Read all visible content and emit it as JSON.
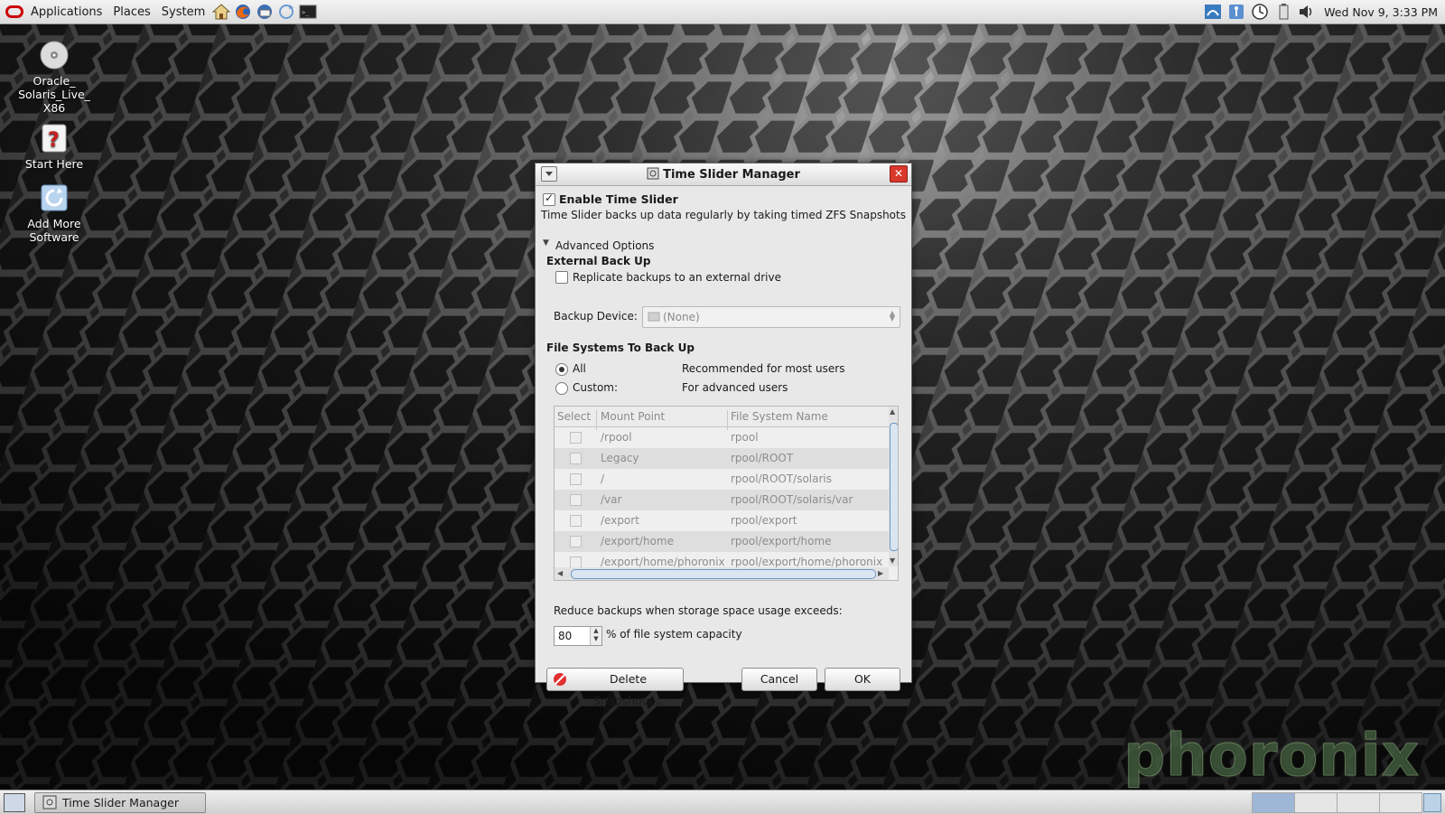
{
  "top_panel": {
    "menus": [
      "Applications",
      "Places",
      "System"
    ],
    "launchers": [
      "home-icon",
      "firefox-icon",
      "thunderbird-icon",
      "update-icon",
      "terminal-icon"
    ],
    "tray_icons": [
      "network-icon",
      "accessibility-icon",
      "time-slider-icon",
      "battery-icon",
      "volume-icon"
    ],
    "clock": "Wed Nov  9,  3:33 PM"
  },
  "desktop_icons": [
    {
      "label": "Oracle_\nSolaris_Live_\nX86",
      "icon": "disc-icon"
    },
    {
      "label": "Start Here",
      "icon": "help-icon"
    },
    {
      "label": "Add More\nSoftware",
      "icon": "package-icon"
    }
  ],
  "dialog": {
    "title": "Time Slider Manager",
    "enable_label": "Enable Time Slider",
    "enable_checked": true,
    "description": "Time Slider backs up data regularly by taking timed ZFS Snapshots",
    "advanced_label": "Advanced Options",
    "external_heading": "External Back Up",
    "replicate_label": "Replicate backups to an external drive",
    "replicate_checked": false,
    "backup_device_label": "Backup Device:",
    "backup_device_value": "(None)",
    "fs_heading": "File Systems To Back Up",
    "radio_all_label": "All",
    "radio_all_desc": "Recommended for most users",
    "radio_custom_label": "Custom:",
    "radio_custom_desc": "For advanced users",
    "selected_radio": "All",
    "table": {
      "headers": [
        "Select",
        "Mount Point",
        "File System Name"
      ],
      "rows": [
        {
          "mount": "/rpool",
          "fs": "rpool"
        },
        {
          "mount": "Legacy",
          "fs": "rpool/ROOT"
        },
        {
          "mount": "/",
          "fs": "rpool/ROOT/solaris"
        },
        {
          "mount": "/var",
          "fs": "rpool/ROOT/solaris/var"
        },
        {
          "mount": "/export",
          "fs": "rpool/export"
        },
        {
          "mount": "/export/home",
          "fs": "rpool/export/home"
        },
        {
          "mount": "/export/home/phoronix",
          "fs": "rpool/export/home/phoronix"
        }
      ]
    },
    "reduce_label": "Reduce backups when storage space usage exceeds:",
    "capacity_value": "80",
    "capacity_suffix": "% of file system capacity",
    "delete_button": "Delete Snapshots...",
    "cancel_button": "Cancel",
    "ok_button": "OK"
  },
  "bottom_panel": {
    "task_label": "Time Slider Manager"
  },
  "watermark": "phoronix"
}
